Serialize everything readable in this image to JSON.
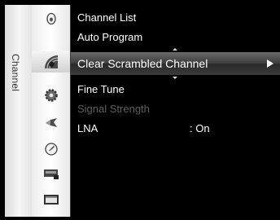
{
  "menu": {
    "tab_label": "Channel",
    "icons": [
      {
        "name": "input-icon",
        "active": false
      },
      {
        "name": "channel-icon",
        "active": true
      },
      {
        "name": "setup-icon",
        "active": false
      },
      {
        "name": "sound-icon",
        "active": false
      },
      {
        "name": "time-icon",
        "active": false
      },
      {
        "name": "picture-icon",
        "active": false
      },
      {
        "name": "support-icon",
        "active": false
      }
    ],
    "items": [
      {
        "label": "Channel List",
        "value": "",
        "state": "normal"
      },
      {
        "label": "Auto Program",
        "value": "",
        "state": "normal"
      },
      {
        "label": "Clear Scrambled Channel",
        "value": "",
        "state": "selected"
      },
      {
        "label": "Fine Tune",
        "value": "",
        "state": "normal"
      },
      {
        "label": "Signal Strength",
        "value": "",
        "state": "disabled"
      },
      {
        "label": "LNA",
        "value": ": On",
        "state": "normal"
      }
    ],
    "colors": {
      "background": "#000000",
      "text": "#ffffff",
      "disabled_text": "#5e5e5e",
      "highlight": "#3e3e3e"
    }
  }
}
